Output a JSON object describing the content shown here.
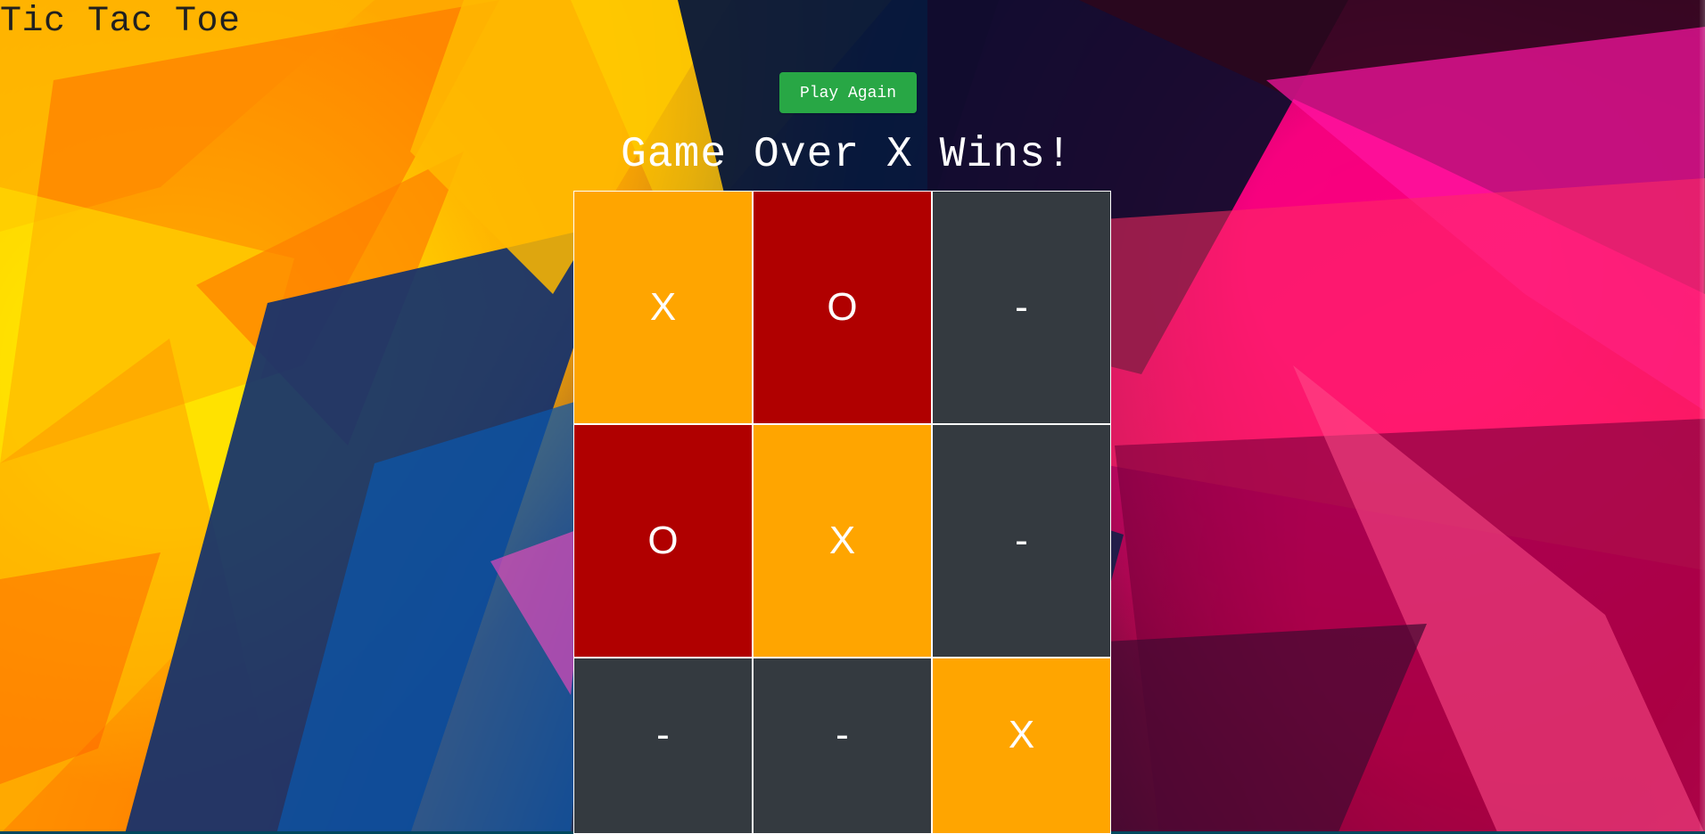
{
  "page": {
    "title": "Tic Tac Toe"
  },
  "controls": {
    "play_again_label": "Play Again"
  },
  "status": {
    "message": "Game Over X Wins!"
  },
  "board": {
    "cells": [
      [
        "X",
        "O",
        "-"
      ],
      [
        "O",
        "X",
        "-"
      ],
      [
        "-",
        "-",
        "X"
      ]
    ]
  },
  "colors": {
    "x_cell": "#ffa500",
    "o_cell": "#b00000",
    "empty_cell": "#343a40",
    "button": "#28a745",
    "text": "#ffffff"
  }
}
